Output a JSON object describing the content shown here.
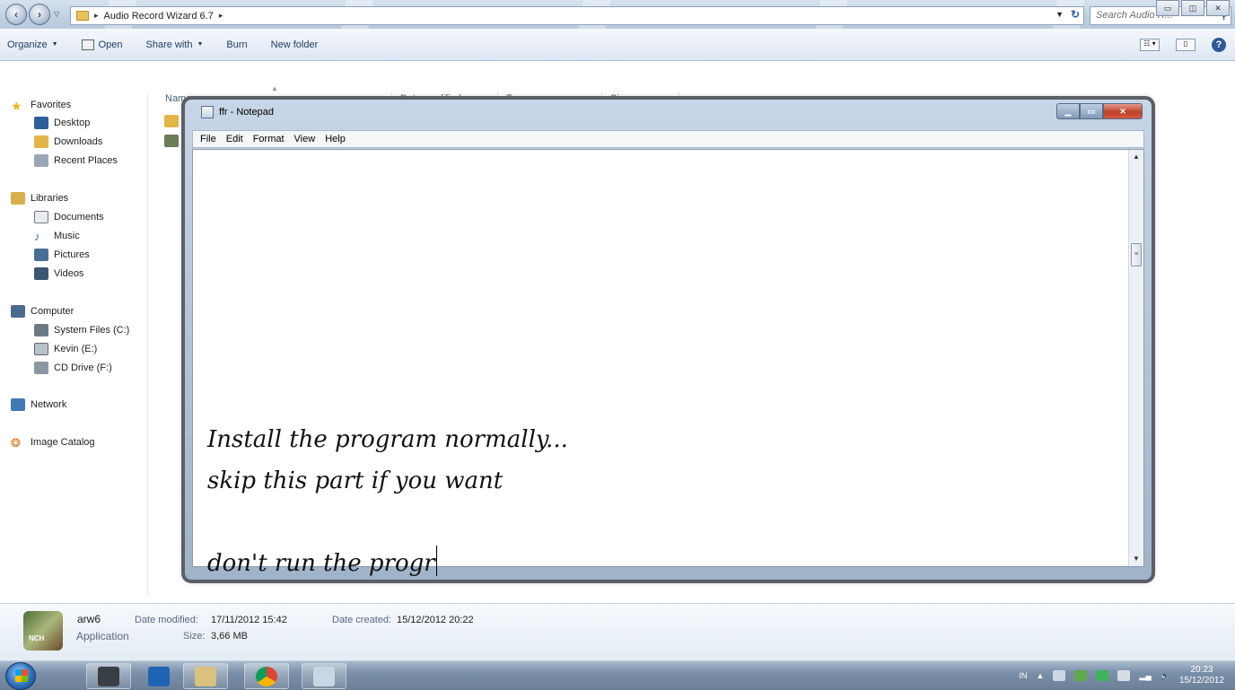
{
  "explorer": {
    "breadcrumb": "Audio Record Wizard 6.7",
    "search_placeholder": "Search Audio R...",
    "toolbar": {
      "organize": "Organize",
      "open": "Open",
      "share_with": "Share with",
      "burn": "Burn",
      "new_folder": "New folder"
    },
    "nav": {
      "favorites": "Favorites",
      "desktop": "Desktop",
      "downloads": "Downloads",
      "recent_places": "Recent Places",
      "libraries": "Libraries",
      "documents": "Documents",
      "music": "Music",
      "pictures": "Pictures",
      "videos": "Videos",
      "computer": "Computer",
      "system_files": "System Files (C:)",
      "kevin": "Kevin (E:)",
      "cd_drive": "CD Drive (F:)",
      "network": "Network",
      "image_catalog": "Image Catalog"
    },
    "columns": {
      "name": "Name",
      "date_modified": "Date modified",
      "type": "Type",
      "size": "Size"
    },
    "details": {
      "file_name": "arw6",
      "file_type": "Application",
      "date_modified_label": "Date modified:",
      "date_modified_value": "17/11/2012 15:42",
      "size_label": "Size:",
      "size_value": "3,66 MB",
      "date_created_label": "Date created:",
      "date_created_value": "15/12/2012 20:22"
    }
  },
  "notepad": {
    "title": "ffr - Notepad",
    "menu": {
      "file": "File",
      "edit": "Edit",
      "format": "Format",
      "view": "View",
      "help": "Help"
    },
    "lines": [
      "Install the program normally...",
      "skip this part if you want",
      "",
      "don't run the progr"
    ]
  },
  "taskbar": {
    "tray_lang": "IN",
    "time": "20:23",
    "date": "15/12/2012"
  }
}
